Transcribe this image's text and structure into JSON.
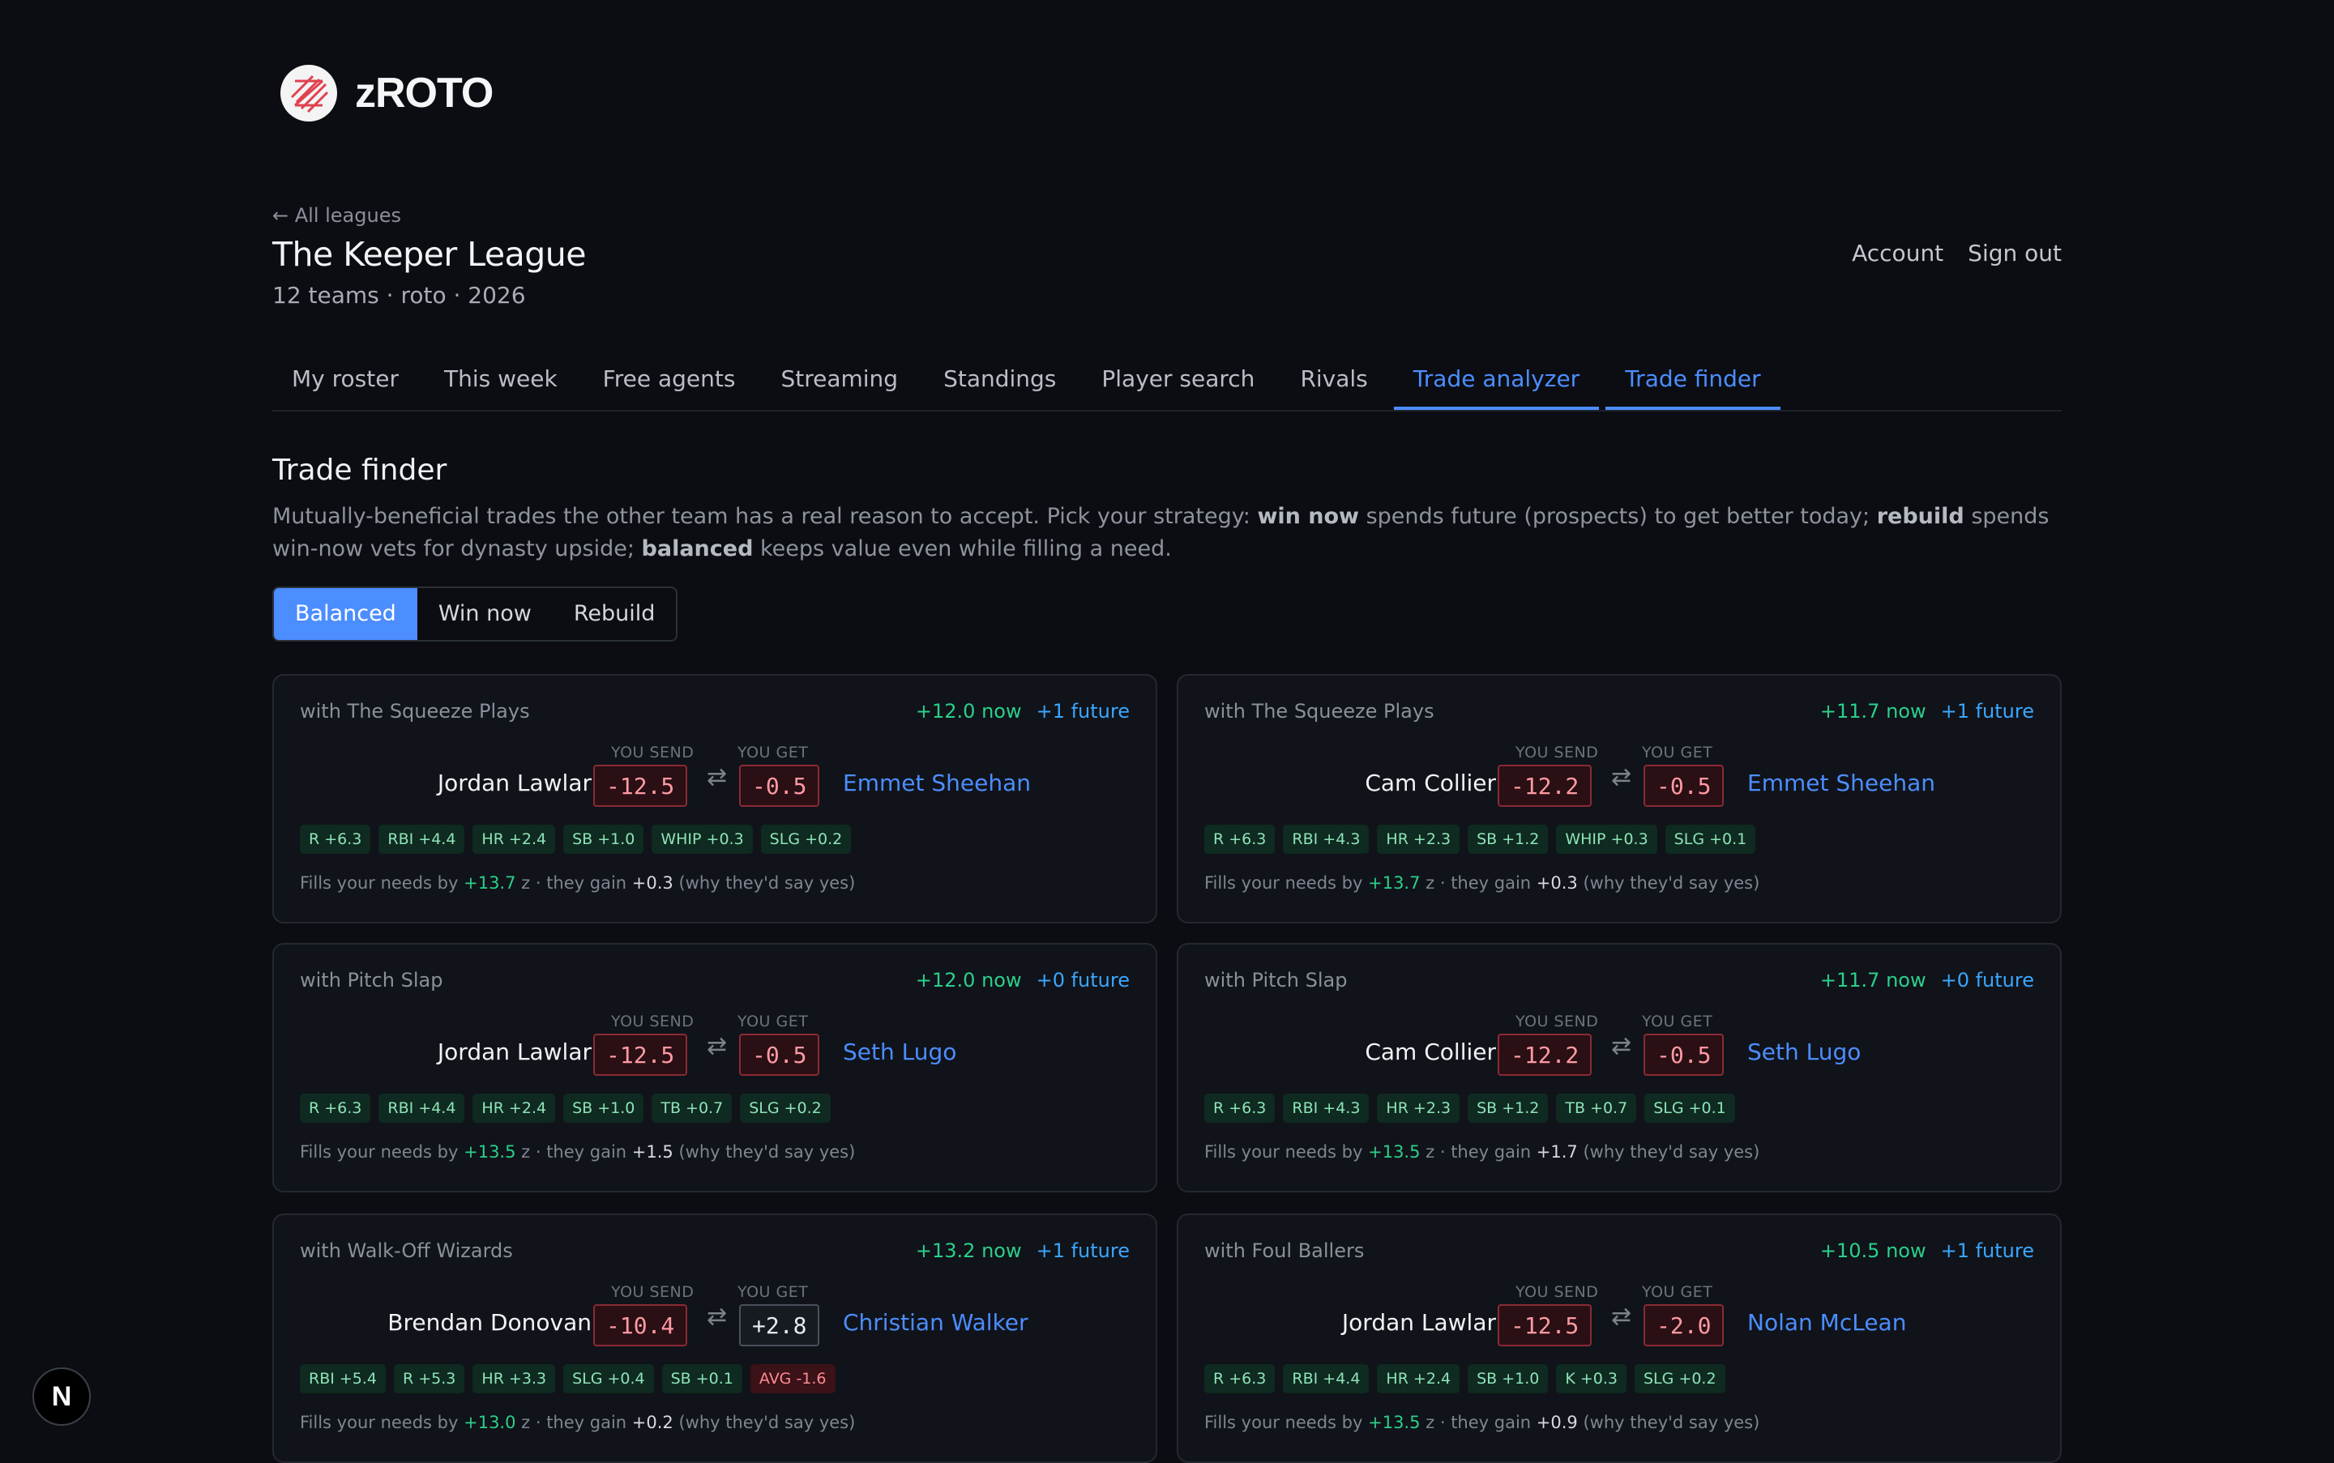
{
  "app": {
    "name": "zROTO"
  },
  "header": {
    "back_link": "← All leagues",
    "league_title": "The Keeper League",
    "league_meta": "12 teams · roto · 2026",
    "account": "Account",
    "sign_out": "Sign out"
  },
  "tabs": [
    {
      "label": "My roster"
    },
    {
      "label": "This week"
    },
    {
      "label": "Free agents"
    },
    {
      "label": "Streaming"
    },
    {
      "label": "Standings"
    },
    {
      "label": "Player search"
    },
    {
      "label": "Rivals"
    },
    {
      "label": "Trade analyzer",
      "active": true
    },
    {
      "label": "Trade finder",
      "active": true
    }
  ],
  "main": {
    "title": "Trade finder",
    "desc_1": "Mutually-beneficial trades the other team has a real reason to accept. Pick your strategy: ",
    "desc_b1": "win now",
    "desc_2": " spends future (prospects) to get better today; ",
    "desc_b2": "rebuild",
    "desc_3": " spends win-now vets for dynasty upside; ",
    "desc_b3": "balanced",
    "desc_4": " keeps value even while filling a need.",
    "strategies": [
      "Balanced",
      "Win now",
      "Rebuild"
    ],
    "selected_strategy": "Balanced"
  },
  "labels": {
    "you_send": "YOU SEND",
    "you_get": "YOU GET",
    "swap_icon": "⇄"
  },
  "trades": [
    {
      "with": "with The Squeeze Plays",
      "now": "+12.0 now",
      "future": "+1 future",
      "send": "Jordan Lawlar",
      "send_z": "-12.5",
      "get_z": "-0.5",
      "get_z_sign": "neg",
      "get": "Emmet Sheehan",
      "chips": [
        {
          "t": "R +6.3",
          "c": "g"
        },
        {
          "t": "RBI +4.4",
          "c": "g"
        },
        {
          "t": "HR +2.4",
          "c": "g"
        },
        {
          "t": "SB +1.0",
          "c": "g"
        },
        {
          "t": "WHIP +0.3",
          "c": "g"
        },
        {
          "t": "SLG +0.2",
          "c": "g"
        }
      ],
      "fill_a": "Fills your needs by ",
      "fill_z": "+13.7",
      "fill_b": " z · they gain ",
      "gain": "+0.3",
      "fill_c": " (why they'd say yes)"
    },
    {
      "with": "with The Squeeze Plays",
      "now": "+11.7 now",
      "future": "+1 future",
      "send": "Cam Collier",
      "send_z": "-12.2",
      "get_z": "-0.5",
      "get_z_sign": "neg",
      "get": "Emmet Sheehan",
      "chips": [
        {
          "t": "R +6.3",
          "c": "g"
        },
        {
          "t": "RBI +4.3",
          "c": "g"
        },
        {
          "t": "HR +2.3",
          "c": "g"
        },
        {
          "t": "SB +1.2",
          "c": "g"
        },
        {
          "t": "WHIP +0.3",
          "c": "g"
        },
        {
          "t": "SLG +0.1",
          "c": "g"
        }
      ],
      "fill_a": "Fills your needs by ",
      "fill_z": "+13.7",
      "fill_b": " z · they gain ",
      "gain": "+0.3",
      "fill_c": " (why they'd say yes)"
    },
    {
      "with": "with Pitch Slap",
      "now": "+12.0 now",
      "future": "+0 future",
      "send": "Jordan Lawlar",
      "send_z": "-12.5",
      "get_z": "-0.5",
      "get_z_sign": "neg",
      "get": "Seth Lugo",
      "chips": [
        {
          "t": "R +6.3",
          "c": "g"
        },
        {
          "t": "RBI +4.4",
          "c": "g"
        },
        {
          "t": "HR +2.4",
          "c": "g"
        },
        {
          "t": "SB +1.0",
          "c": "g"
        },
        {
          "t": "TB +0.7",
          "c": "g"
        },
        {
          "t": "SLG +0.2",
          "c": "g"
        }
      ],
      "fill_a": "Fills your needs by ",
      "fill_z": "+13.5",
      "fill_b": " z · they gain ",
      "gain": "+1.5",
      "fill_c": " (why they'd say yes)"
    },
    {
      "with": "with Pitch Slap",
      "now": "+11.7 now",
      "future": "+0 future",
      "send": "Cam Collier",
      "send_z": "-12.2",
      "get_z": "-0.5",
      "get_z_sign": "neg",
      "get": "Seth Lugo",
      "chips": [
        {
          "t": "R +6.3",
          "c": "g"
        },
        {
          "t": "RBI +4.3",
          "c": "g"
        },
        {
          "t": "HR +2.3",
          "c": "g"
        },
        {
          "t": "SB +1.2",
          "c": "g"
        },
        {
          "t": "TB +0.7",
          "c": "g"
        },
        {
          "t": "SLG +0.1",
          "c": "g"
        }
      ],
      "fill_a": "Fills your needs by ",
      "fill_z": "+13.5",
      "fill_b": " z · they gain ",
      "gain": "+1.7",
      "fill_c": " (why they'd say yes)"
    },
    {
      "with": "with Walk-Off Wizards",
      "now": "+13.2 now",
      "future": "+1 future",
      "send": "Brendan Donovan",
      "send_z": "-10.4",
      "get_z": "+2.8",
      "get_z_sign": "pos",
      "get": "Christian Walker",
      "chips": [
        {
          "t": "RBI +5.4",
          "c": "g"
        },
        {
          "t": "R +5.3",
          "c": "g"
        },
        {
          "t": "HR +3.3",
          "c": "g"
        },
        {
          "t": "SLG +0.4",
          "c": "g"
        },
        {
          "t": "SB +0.1",
          "c": "g"
        },
        {
          "t": "AVG -1.6",
          "c": "r"
        }
      ],
      "fill_a": "Fills your needs by ",
      "fill_z": "+13.0",
      "fill_b": " z · they gain ",
      "gain": "+0.2",
      "fill_c": " (why they'd say yes)"
    },
    {
      "with": "with Foul Ballers",
      "now": "+10.5 now",
      "future": "+1 future",
      "send": "Jordan Lawlar",
      "send_z": "-12.5",
      "get_z": "-2.0",
      "get_z_sign": "neg",
      "get": "Nolan McLean",
      "chips": [
        {
          "t": "R +6.3",
          "c": "g"
        },
        {
          "t": "RBI +4.4",
          "c": "g"
        },
        {
          "t": "HR +2.4",
          "c": "g"
        },
        {
          "t": "SB +1.0",
          "c": "g"
        },
        {
          "t": "K +0.3",
          "c": "g"
        },
        {
          "t": "SLG +0.2",
          "c": "g"
        }
      ],
      "fill_a": "Fills your needs by ",
      "fill_z": "+13.5",
      "fill_b": " z · they gain ",
      "gain": "+0.9",
      "fill_c": " (why they'd say yes)"
    }
  ],
  "devtools_badge": "N",
  "colors": {
    "accent": "#4c8dff",
    "positive": "#2bcf8a",
    "future": "#3aa6ff",
    "negative": "#ff9aa3"
  }
}
